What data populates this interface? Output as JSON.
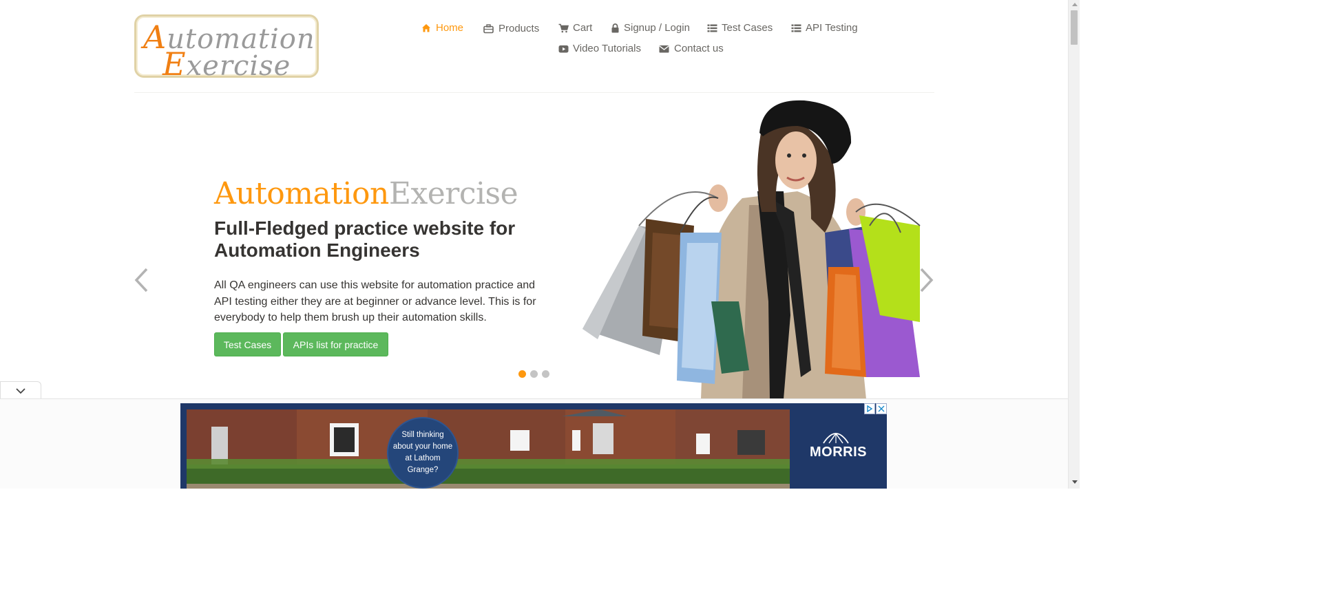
{
  "logo": {
    "line1": "Automation",
    "line2": "Exercise",
    "cap1": "A",
    "rest1": "utomation",
    "cap2": "E",
    "rest2": "xercise"
  },
  "nav": {
    "home": "Home",
    "products": "Products",
    "cart": "Cart",
    "signup": "Signup / Login",
    "test_cases": "Test Cases",
    "api_testing": "API Testing",
    "video_tutorials": "Video Tutorials",
    "contact": "Contact us"
  },
  "hero": {
    "brand_a": "Automation",
    "brand_b": "Exercise",
    "heading": "Full-Fledged practice website for Automation Engineers",
    "paragraph": "All QA engineers can use this website for automation practice and API testing either they are at beginner or advance level. This is for everybody to help them brush up their automation skills.",
    "btn_test_cases": "Test Cases",
    "btn_apis": "APIs list for practice",
    "active_slide": 1,
    "slide_count": 3
  },
  "ad": {
    "circle_text": "Still thinking about your home at Lathom Grange?",
    "brand": "MORRIS"
  },
  "colors": {
    "accent": "#fe980f",
    "button_green": "#5cb85c",
    "text_dark": "#363432",
    "text_nav": "#696763",
    "ad_navy": "#1f3868"
  },
  "icons": [
    "home-icon",
    "briefcase-icon",
    "cart-icon",
    "lock-icon",
    "list-icon",
    "list-icon",
    "youtube-icon",
    "envelope-icon",
    "chevron-left-icon",
    "chevron-right-icon",
    "chevron-down-icon",
    "ad-choices-icon",
    "close-icon"
  ]
}
